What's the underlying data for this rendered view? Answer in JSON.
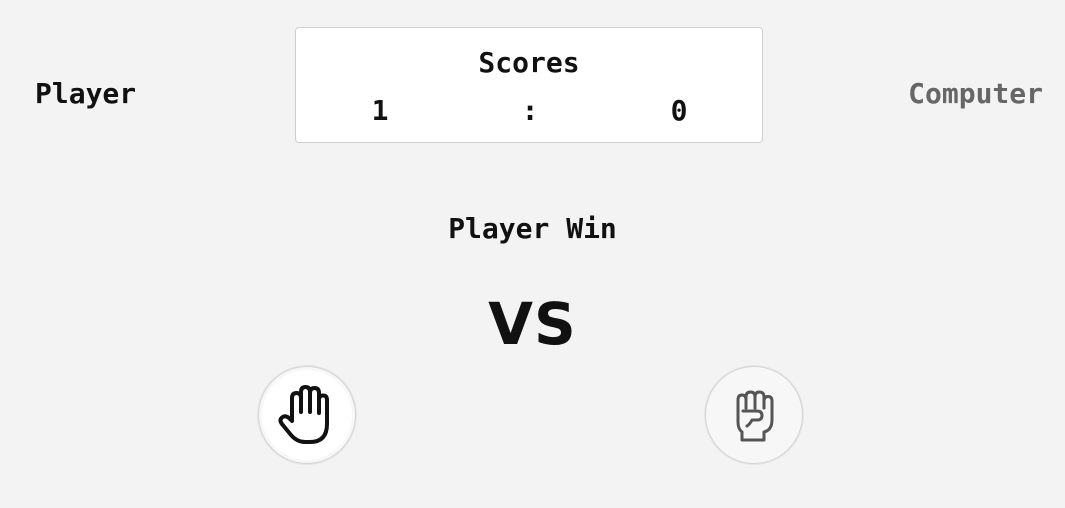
{
  "labels": {
    "player": "Player",
    "computer": "Computer"
  },
  "scoreboard": {
    "title": "Scores",
    "player_score": "1",
    "separator": ":",
    "computer_score": "0"
  },
  "result": {
    "text": "Player Win"
  },
  "versus": "VS",
  "choices": {
    "player": {
      "icon": "hand-paper-icon"
    },
    "computer": {
      "icon": "hand-rock-icon"
    }
  },
  "colors": {
    "background": "#f3f3f3",
    "text": "#111111",
    "computer_label": "#666666",
    "card": "#ffffff"
  }
}
